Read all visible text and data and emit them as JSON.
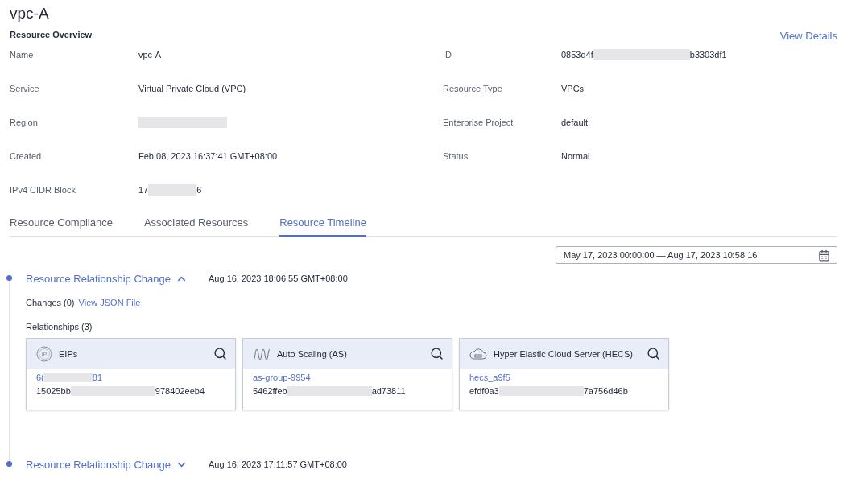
{
  "title": "vpc-A",
  "overview": {
    "heading": "Resource Overview",
    "link": "View Details",
    "fields": [
      {
        "label": "Name",
        "parts": [
          "vpc-A"
        ]
      },
      {
        "label": "ID",
        "parts": [
          "0853d4f",
          "b3303df1"
        ]
      },
      {
        "label": "Service",
        "parts": [
          "Virtual Private Cloud (VPC)"
        ]
      },
      {
        "label": "Resource Type",
        "parts": [
          "VPCs"
        ]
      },
      {
        "label": "Region",
        "masked": true
      },
      {
        "label": "Enterprise Project",
        "parts": [
          "default"
        ]
      },
      {
        "label": "Created",
        "parts": [
          "Feb 08, 2023 16:37:41 GMT+08:00"
        ]
      },
      {
        "label": "Status",
        "parts": [
          "Normal"
        ]
      },
      {
        "label": "IPv4 CIDR Block",
        "parts": [
          "17",
          "6"
        ]
      }
    ]
  },
  "tabs": [
    {
      "label": "Resource Compliance",
      "selected": false
    },
    {
      "label": "Associated Resources",
      "selected": false
    },
    {
      "label": "Resource Timeline",
      "selected": true
    }
  ],
  "date_range": {
    "start": "May 17, 2023 00:00:00",
    "separator": "—",
    "end": "Aug 17, 2023 10:58:16"
  },
  "events": [
    {
      "title": "Resource Relationship Change",
      "expanded": true,
      "time": "Aug 16, 2023 18:06:55 GMT+08:00",
      "changes": "Changes (0)",
      "link": "View JSON File",
      "relationships": "Relationships (3)",
      "cards": [
        {
          "kind": "eip",
          "icon_label": "IP",
          "name": "EIPs",
          "link_parts": [
            "6(",
            "81"
          ],
          "id_parts": [
            "15025bb",
            "978402eeb4"
          ]
        },
        {
          "kind": "scaling",
          "name": "Auto Scaling (AS)",
          "link_parts": [
            "as-group-9954"
          ],
          "id_parts": [
            "5462ffeb",
            "ad73811"
          ]
        },
        {
          "kind": "cloud",
          "name": "Hyper Elastic Cloud Server (HECS)",
          "link_parts": [
            "hecs_a9f5"
          ],
          "id_parts": [
            "efdf0a3",
            "7a756d46b"
          ]
        }
      ]
    },
    {
      "title": "Resource Relationship Change",
      "expanded": false,
      "time": "Aug 16, 2023 17:11:57 GMT+08:00"
    }
  ]
}
